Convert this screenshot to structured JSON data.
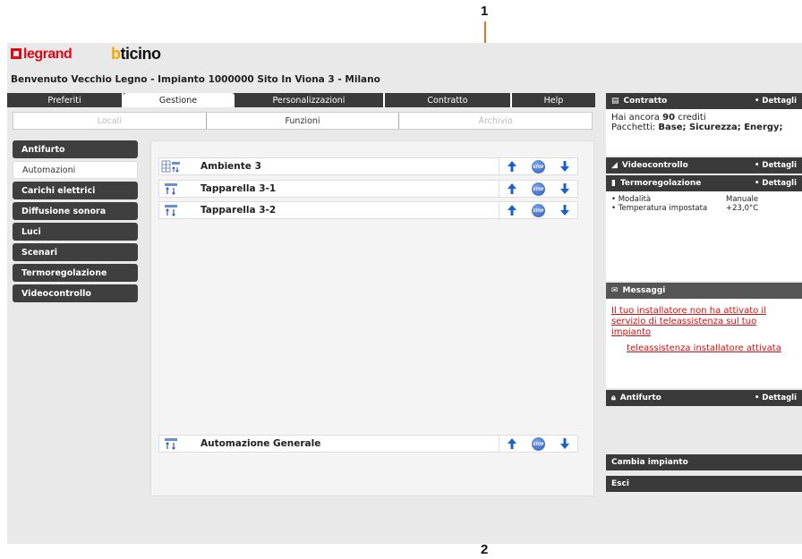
{
  "callouts": [
    "1",
    "2"
  ],
  "brand": {
    "legrand": "legrand",
    "bticino": "bticino"
  },
  "welcome": "Benvenuto Vecchio Legno - Impianto 1000000 Sito In Viona 3 - Milano",
  "main_tabs": [
    {
      "label": "Preferiti",
      "active": false
    },
    {
      "label": "Gestione",
      "active": true
    },
    {
      "label": "Personalizzazioni",
      "active": false
    },
    {
      "label": "Contratto",
      "active": false
    },
    {
      "label": "Help",
      "active": false
    }
  ],
  "sub_tabs": [
    {
      "label": "Locali",
      "active": false
    },
    {
      "label": "Funzioni",
      "active": true
    },
    {
      "label": "Archivio",
      "active": false
    }
  ],
  "menu": [
    {
      "label": "Antifurto",
      "active": false
    },
    {
      "label": "Automazioni",
      "active": true
    },
    {
      "label": "Carichi elettrici",
      "active": false
    },
    {
      "label": "Diffusione sonora",
      "active": false
    },
    {
      "label": "Luci",
      "active": false
    },
    {
      "label": "Scenari",
      "active": false
    },
    {
      "label": "Termoregolazione",
      "active": false
    },
    {
      "label": "Videocontrollo",
      "active": false
    }
  ],
  "devices": [
    {
      "label": "Ambiente 3",
      "icon": "room-blinds-icon"
    },
    {
      "label": "Tapparella 3-1",
      "icon": "blind-icon"
    },
    {
      "label": "Tapparella 3-2",
      "icon": "blind-icon"
    }
  ],
  "general": {
    "label": "Automazione Generale",
    "icon": "blind-icon"
  },
  "stop_text": "STOP",
  "right": {
    "contratto": {
      "title": "Contratto",
      "details": "• Dettagli",
      "credits_prefix": "Hai ancora",
      "credits_value": "90",
      "credits_suffix": "crediti",
      "packages_label": "Pacchetti:",
      "packages_value": "Base; Sicurezza; Energy;"
    },
    "video": {
      "title": "Videocontrollo",
      "details": "• Dettagli"
    },
    "termo": {
      "title": "Termoregolazione",
      "details": "• Dettagli",
      "rows": [
        {
          "label": "• Modalità",
          "value": "Manuale"
        },
        {
          "label": "• Temperatura impostata",
          "value": "+23,0°C"
        }
      ]
    },
    "messaggi": {
      "title": "Messaggi",
      "msg1": "Il tuo installatore non ha attivato il servizio di teleassistenza sul tuo impianto",
      "msg2": "teleassistenza installatore attivata"
    },
    "antifurto": {
      "title": "Antifurto",
      "details": "• Dettagli"
    },
    "cambia": "Cambia impianto",
    "esci": "Esci"
  },
  "colors": {
    "accent_orange": "#e8722c",
    "arrow_blue": "#1a5fd0",
    "link_red": "#d01010",
    "dark_bar": "#3a3a3a"
  }
}
